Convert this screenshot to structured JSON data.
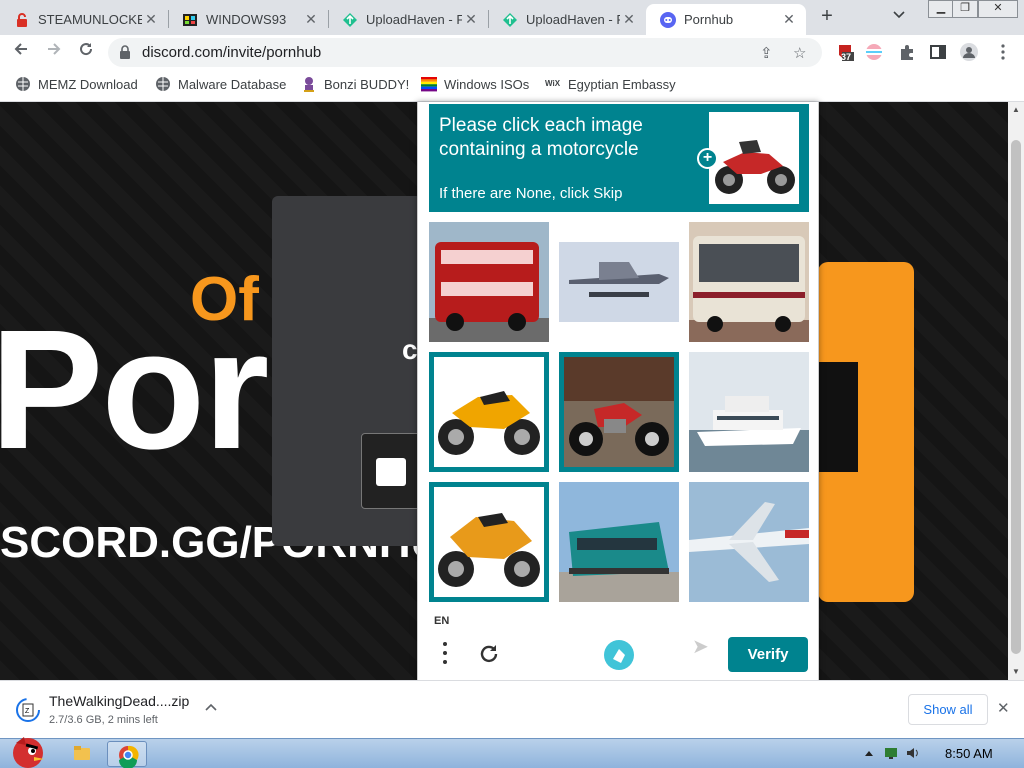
{
  "browser": {
    "tabs": [
      {
        "title": "STEAMUNLOCKED",
        "active": false
      },
      {
        "title": "WINDOWS93",
        "active": false
      },
      {
        "title": "UploadHaven - F",
        "active": false
      },
      {
        "title": "UploadHaven - F",
        "active": false
      },
      {
        "title": "Pornhub",
        "active": true
      }
    ],
    "new_tab": "+",
    "tab_list": "⌄",
    "url": "discord.com/invite/pornhub",
    "extension_badge": "37",
    "bookmarks": [
      {
        "label": "MEMZ Download"
      },
      {
        "label": "Malware Database"
      },
      {
        "label": "Bonzi BUDDY!"
      },
      {
        "label": "Windows ISOs"
      },
      {
        "label": "Egyptian Embassy"
      }
    ]
  },
  "page": {
    "logo_of": "Of",
    "logo_main": "Por",
    "invite_text": "SCORD.GG/PORNHU",
    "partial_char": "c"
  },
  "captcha": {
    "prompt": "Please click each image containing a motorcycle",
    "skip_hint": "If there are None, click Skip",
    "language": "EN",
    "verify_label": "Verify",
    "accent_color": "#00838f",
    "tiles": [
      {
        "subject": "double-decker bus",
        "selected": false
      },
      {
        "subject": "seaplane",
        "selected": false
      },
      {
        "subject": "bus",
        "selected": false
      },
      {
        "subject": "motorcycle",
        "selected": true
      },
      {
        "subject": "motorcycle",
        "selected": true
      },
      {
        "subject": "yacht",
        "selected": false
      },
      {
        "subject": "motorcycle",
        "selected": true
      },
      {
        "subject": "train",
        "selected": false
      },
      {
        "subject": "airplane",
        "selected": false
      }
    ]
  },
  "download": {
    "filename": "TheWalkingDead....zip",
    "status": "2.7/3.6 GB, 2 mins left",
    "show_all": "Show all"
  },
  "taskbar": {
    "time": "8:50 AM"
  }
}
